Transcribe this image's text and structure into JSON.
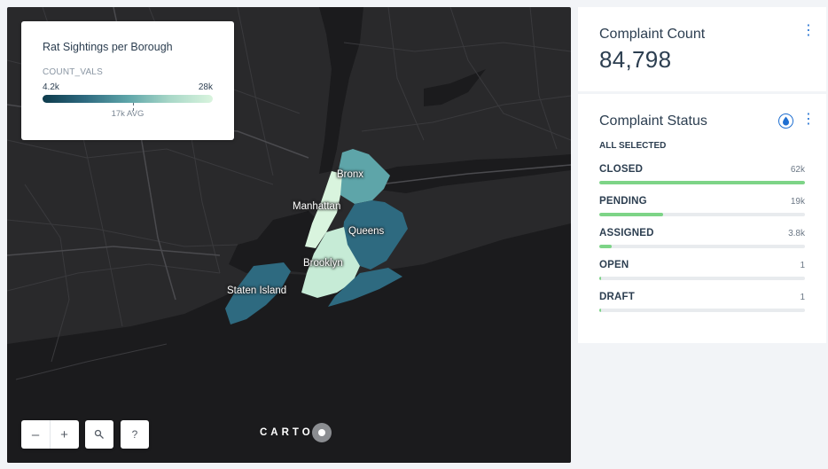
{
  "legend": {
    "title": "Rat Sightings per Borough",
    "field": "COUNT_VALS",
    "min_label": "4.2k",
    "max_label": "28k",
    "avg_label": "17k AVG",
    "gradient_colors": [
      "#0d3b4c",
      "#2e6a80",
      "#5ea5a9",
      "#a9d8c8",
      "#d9f4de"
    ]
  },
  "map": {
    "labels": {
      "bronx": "Bronx",
      "manhattan": "Manhattan",
      "queens": "Queens",
      "brooklyn": "Brooklyn",
      "staten_island": "Staten Island"
    },
    "controls": {
      "zoom_out": "–",
      "zoom_in": "+",
      "search_icon": "search-icon",
      "help": "?"
    },
    "attribution": "CARTO"
  },
  "count_widget": {
    "title": "Complaint Count",
    "value": "84,798",
    "menu_icon": "more-vertical-icon"
  },
  "status_widget": {
    "title": "Complaint Status",
    "filter_icon": "drop-icon",
    "menu_icon": "more-vertical-icon",
    "selection_label": "ALL SELECTED",
    "bar_color": "#7dd487",
    "categories": [
      {
        "name": "CLOSED",
        "value": "62k",
        "fraction": 1.0
      },
      {
        "name": "PENDING",
        "value": "19k",
        "fraction": 0.31
      },
      {
        "name": "ASSIGNED",
        "value": "3.8k",
        "fraction": 0.06
      },
      {
        "name": "OPEN",
        "value": "1",
        "fraction": 0.005
      },
      {
        "name": "DRAFT",
        "value": "1",
        "fraction": 0.005
      }
    ]
  }
}
